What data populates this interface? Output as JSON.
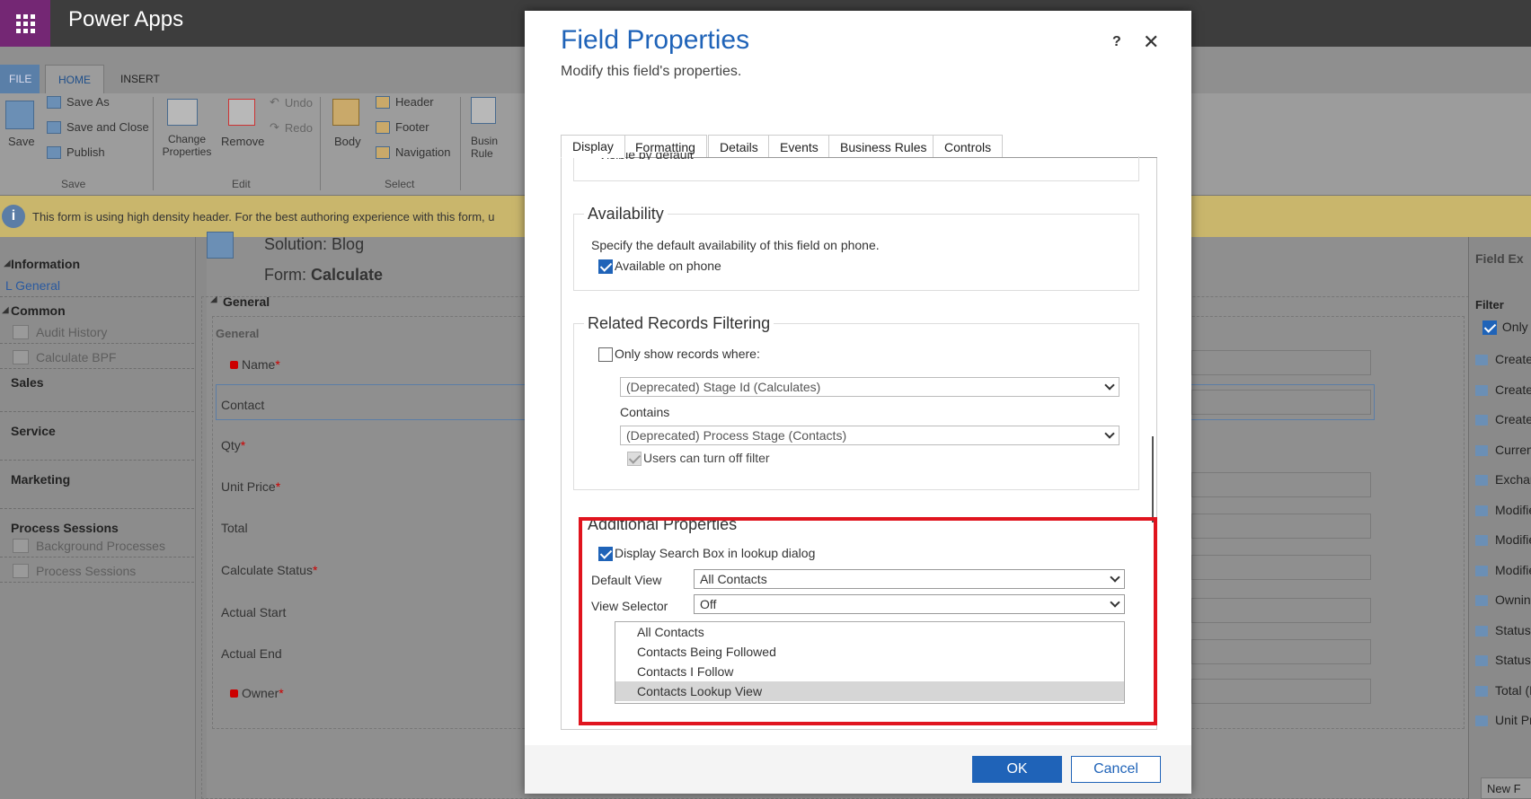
{
  "app": {
    "title": "Power Apps"
  },
  "ribbon": {
    "tabs": [
      "FILE",
      "HOME",
      "INSERT"
    ],
    "save": "Save",
    "save_as": "Save As",
    "save_close": "Save and Close",
    "publish": "Publish",
    "group_save": "Save",
    "change_properties": "Change Properties",
    "remove": "Remove",
    "undo": "Undo",
    "redo": "Redo",
    "group_edit": "Edit",
    "body": "Body",
    "header": "Header",
    "footer": "Footer",
    "navigation": "Navigation",
    "group_select": "Select",
    "business_rules": "Busin Rule"
  },
  "banner": {
    "text": "This form is using high density header. For the best authoring experience with this form, u"
  },
  "leftnav": {
    "information": "Information",
    "general": "General",
    "common": "Common",
    "audit_history": "Audit History",
    "calculate_bpf": "Calculate BPF",
    "sales": "Sales",
    "service": "Service",
    "marketing": "Marketing",
    "process_sessions_h": "Process Sessions",
    "background_processes": "Background Processes",
    "process_sessions": "Process Sessions"
  },
  "form": {
    "solution_label": "Solution: Blog",
    "form_label": "Form:",
    "form_name": "Calculate",
    "section_header": "General",
    "section_label": "General",
    "fields": [
      "Name",
      "Contact",
      "Qty",
      "Unit Price",
      "Total",
      "Calculate Status",
      "Actual Start",
      "Actual End",
      "Owner"
    ],
    "required_mark": "*"
  },
  "rightpanel": {
    "title": "Field Ex",
    "filter": "Filter",
    "only": "Only",
    "items": [
      "Create",
      "Create",
      "Create",
      "Curren",
      "Exchan",
      "Modifie",
      "Modifie",
      "Modifie",
      "Ownin",
      "Status",
      "Status",
      "Total (E",
      "Unit Pr"
    ],
    "new_btn": "New F"
  },
  "dialog": {
    "title": "Field Properties",
    "subtitle": "Modify this field's properties.",
    "help": "?",
    "close": "✕",
    "tabs": [
      "Display",
      "Formatting",
      "Details",
      "Events",
      "Business Rules",
      "Controls"
    ],
    "visible_by_default": "Visible by default",
    "availability": {
      "legend": "Availability",
      "desc": "Specify the default availability of this field on phone.",
      "available_on_phone": "Available on phone"
    },
    "related": {
      "legend": "Related Records Filtering",
      "only_show": "Only show records where:",
      "select1": "(Deprecated) Stage Id (Calculates)",
      "contains": "Contains",
      "select2": "(Deprecated) Process Stage (Contacts)",
      "users_can_turn_off": "Users can turn off filter"
    },
    "additional": {
      "legend": "Additional Properties",
      "display_search_box": "Display Search Box in lookup dialog",
      "default_view_label": "Default View",
      "default_view_value": "All Contacts",
      "view_selector_label": "View Selector",
      "view_selector_value": "Off",
      "views": [
        "All Contacts",
        "Contacts Being Followed",
        "Contacts I Follow",
        "Contacts Lookup View"
      ]
    },
    "ok": "OK",
    "cancel": "Cancel"
  },
  "colors": {
    "accent": "#1f63b8",
    "highlight": "#e0141e",
    "banner": "#c9b66c",
    "brand": "#742774"
  }
}
